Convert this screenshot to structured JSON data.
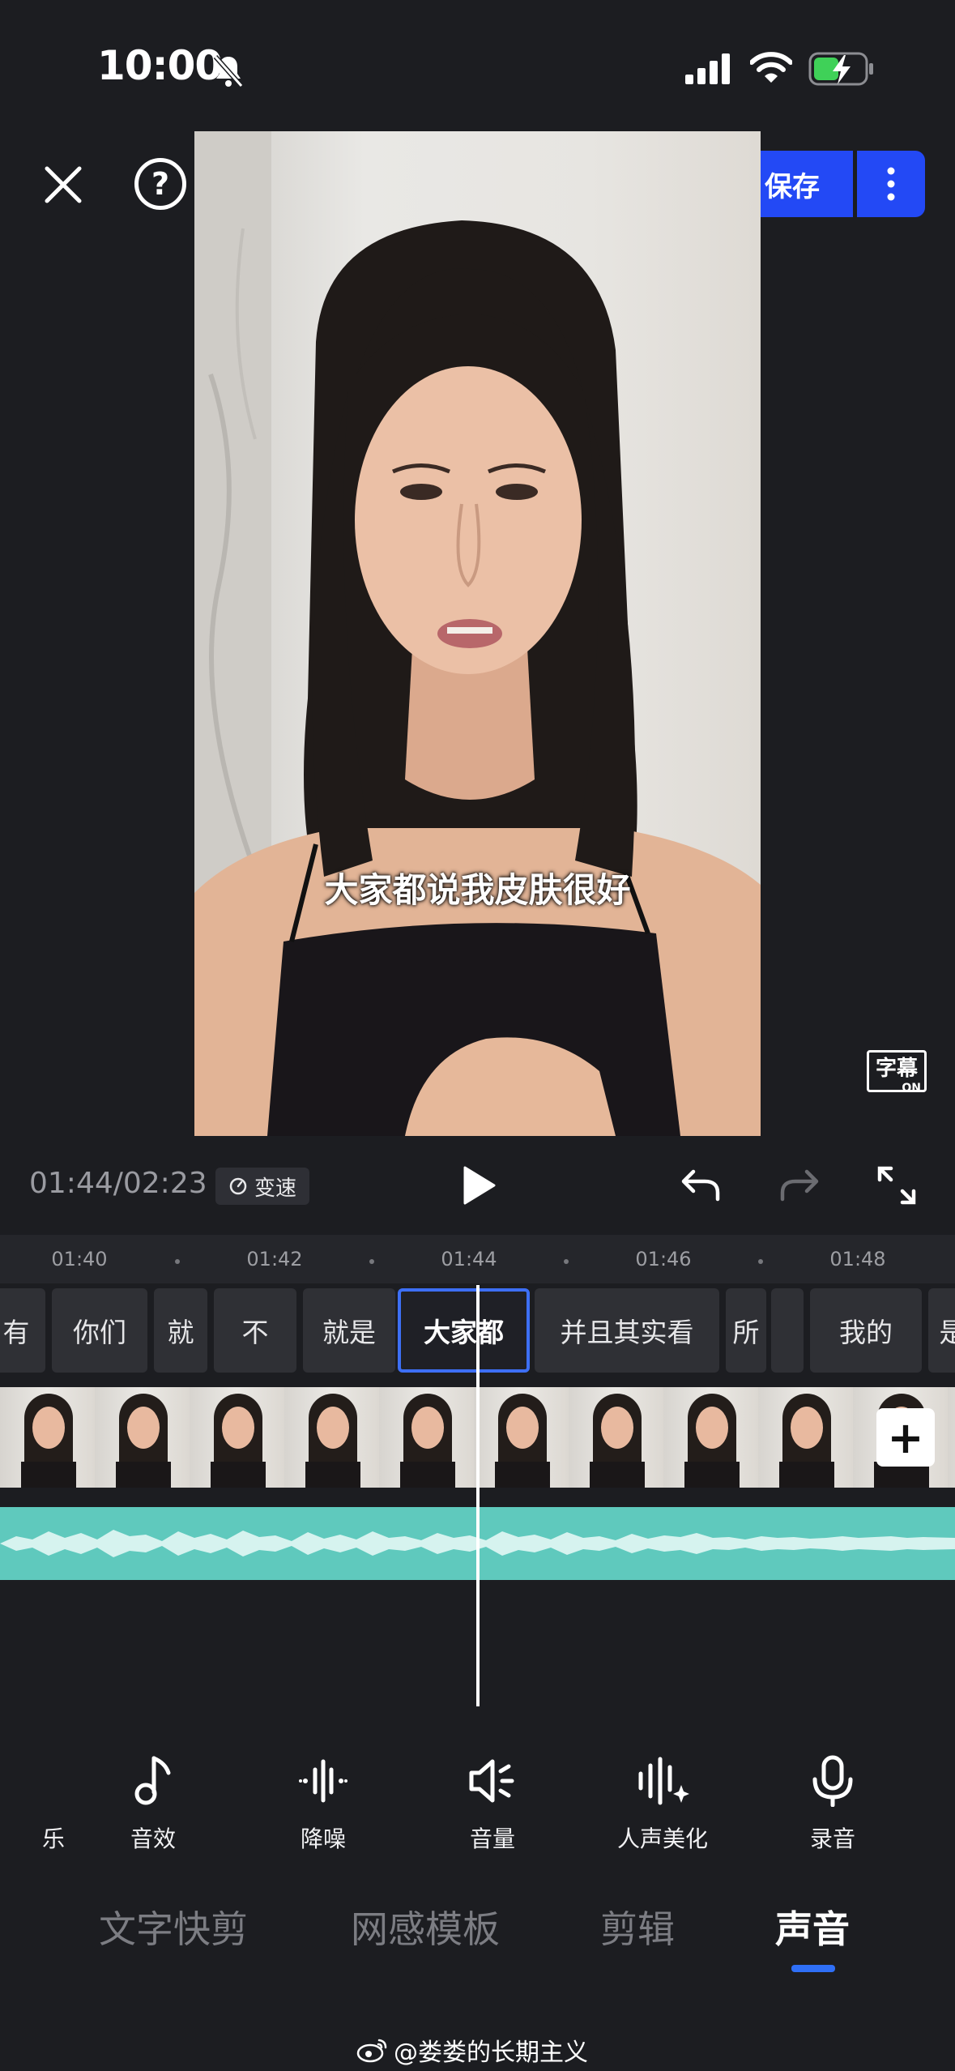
{
  "status_bar": {
    "time": "10:00"
  },
  "header": {
    "save_label": "保存",
    "help_symbol": "?"
  },
  "preview": {
    "subtitle": "大家都说我皮肤很好",
    "caption_badge": "字幕",
    "caption_state": "ON"
  },
  "playback": {
    "timecode": "01:44/02:23",
    "speed_label": "变速"
  },
  "timeline": {
    "ruler_ticks": [
      "01:40",
      "01:42",
      "01:44",
      "01:46",
      "01:48"
    ],
    "words": [
      "有",
      "你们",
      "就",
      "不",
      "就是",
      "大家都",
      "并且其实看",
      "所",
      "",
      "我的",
      "是"
    ],
    "selected_word": "大家都"
  },
  "tools": [
    "乐",
    "音效",
    "降噪",
    "音量",
    "人声美化",
    "录音"
  ],
  "tabs": [
    "文字快剪",
    "网感模板",
    "剪辑",
    "声音"
  ],
  "active_tab": "声音",
  "watermark": "@娄娄的长期主义",
  "colors": {
    "accent": "#2349f5",
    "audio_wave": "#5fc9bd",
    "background": "#1c1d21"
  }
}
